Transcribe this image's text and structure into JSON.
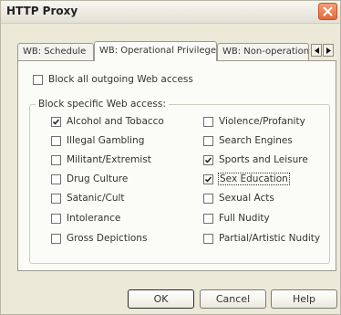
{
  "window": {
    "title": "HTTP Proxy"
  },
  "tabs": [
    {
      "label": "WB: Schedule"
    },
    {
      "label": "WB: Operational Privileges"
    },
    {
      "label": "WB: Non-operation"
    }
  ],
  "active_tab": "WB: Operational Privileges",
  "block_all": {
    "label": "Block all outgoing Web access",
    "checked": false
  },
  "group": {
    "label": "Block specific Web access:",
    "left_column": [
      {
        "label": "Alcohol and Tobacco",
        "checked": true
      },
      {
        "label": "Illegal Gambling",
        "checked": false
      },
      {
        "label": "Militant/Extremist",
        "checked": false
      },
      {
        "label": "Drug Culture",
        "checked": false
      },
      {
        "label": "Satanic/Cult",
        "checked": false
      },
      {
        "label": "Intolerance",
        "checked": false
      },
      {
        "label": "Gross Depictions",
        "checked": false
      }
    ],
    "right_column": [
      {
        "label": "Violence/Profanity",
        "checked": false
      },
      {
        "label": "Search Engines",
        "checked": false
      },
      {
        "label": "Sports and Leisure",
        "checked": true
      },
      {
        "label": "Sex Education",
        "checked": true
      },
      {
        "label": "Sexual Acts",
        "checked": false
      },
      {
        "label": "Full Nudity",
        "checked": false
      },
      {
        "label": "Partial/Artistic Nudity",
        "checked": false
      }
    ]
  },
  "buttons": {
    "ok": "OK",
    "cancel": "Cancel",
    "help": "Help"
  }
}
